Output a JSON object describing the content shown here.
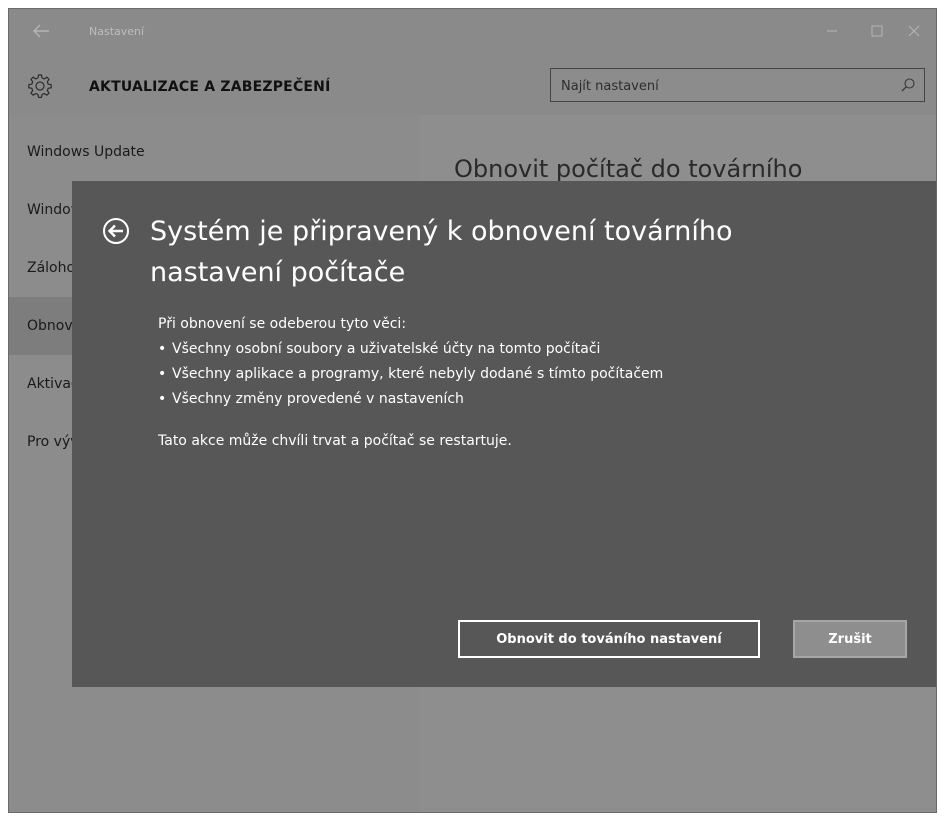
{
  "window": {
    "title": "Nastavení"
  },
  "header": {
    "section_title": "AKTUALIZACE A ZABEZPEČENÍ",
    "search_placeholder": "Najít nastavení"
  },
  "sidebar": {
    "items": [
      {
        "label": "Windows Update",
        "selected": false
      },
      {
        "label": "Windows Defender",
        "selected": false
      },
      {
        "label": "Zálohování",
        "selected": false
      },
      {
        "label": "Obnovení",
        "selected": true
      },
      {
        "label": "Aktivace",
        "selected": false
      },
      {
        "label": "Pro vývojáře",
        "selected": false
      }
    ]
  },
  "content": {
    "title": "Obnovit počítač do továrního"
  },
  "dialog": {
    "title": "Systém je připravený k obnovení továrního nastavení počítače",
    "intro": "Při obnovení se odeberou tyto věci:",
    "bullets": [
      "Všechny osobní soubory a uživatelské účty na tomto počítači",
      "Všechny aplikace a programy, které nebyly dodané s tímto počítačem",
      "Všechny změny provedené v nastaveních"
    ],
    "note": "Tato akce může chvíli trvat a počítač se restartuje.",
    "reset_button": "Obnovit do továního nastavení",
    "cancel_button": "Zrušit"
  },
  "colors": {
    "dialog_bg": "#575757",
    "window_bg": "#8c8c8c",
    "text_light": "#ffffff",
    "text_dark": "#111111"
  },
  "icons": {
    "back": "back-arrow-icon",
    "gear": "gear-icon",
    "search": "search-icon",
    "minimize": "minimize-icon",
    "maximize": "maximize-icon",
    "close": "close-icon",
    "dialog_back": "circle-back-arrow-icon"
  }
}
